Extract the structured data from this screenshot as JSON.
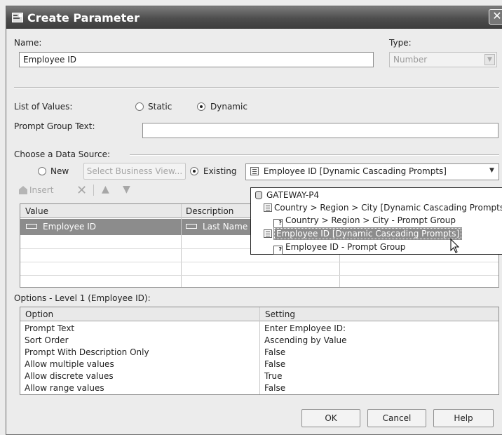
{
  "window": {
    "title": "Create Parameter",
    "close_glyph": "✕"
  },
  "name_section": {
    "name_label": "Name:",
    "name_value": "Employee ID",
    "type_label": "Type:",
    "type_value": "Number"
  },
  "list_of_values": {
    "label": "List of Values:",
    "static_label": "Static",
    "dynamic_label": "Dynamic",
    "selected": "Dynamic"
  },
  "prompt_group": {
    "label": "Prompt Group Text:",
    "value": ""
  },
  "data_source": {
    "label": "Choose a Data Source:",
    "new_label": "New",
    "select_business_view_label": "Select Business View...",
    "existing_label": "Existing",
    "selected_source": "Employee ID [Dynamic Cascading Prompts]",
    "selected_option": "Existing"
  },
  "toolbar": {
    "insert_label": "Insert",
    "delete_icon": "delete-icon",
    "up_icon": "arrow-up-icon",
    "down_icon": "arrow-down-icon"
  },
  "value_grid": {
    "columns": [
      "Value",
      "Description"
    ],
    "rows": [
      {
        "value": "Employee ID",
        "description": "Last Name"
      }
    ]
  },
  "dropdown_popup": {
    "items": [
      {
        "text": "GATEWAY-P4",
        "icon": "database-icon",
        "indent": 0,
        "selected": false
      },
      {
        "text": "Country > Region > City [Dynamic Cascading Prompts]",
        "icon": "cascade-prompt-icon",
        "indent": 1,
        "selected": false
      },
      {
        "text": "Country > Region > City - Prompt Group",
        "icon": "prompt-group-icon",
        "indent": 2,
        "selected": false
      },
      {
        "text": "Employee ID [Dynamic Cascading Prompts]",
        "icon": "cascade-prompt-icon",
        "indent": 1,
        "selected": true
      },
      {
        "text": "Employee ID - Prompt Group",
        "icon": "prompt-group-icon",
        "indent": 2,
        "selected": false
      }
    ]
  },
  "options": {
    "section_label": "Options - Level 1 (Employee ID):",
    "columns": [
      "Option",
      "Setting"
    ],
    "rows": [
      {
        "option": "Prompt Text",
        "setting": "Enter Employee ID:"
      },
      {
        "option": "Sort Order",
        "setting": "Ascending by Value"
      },
      {
        "option": "Prompt With Description Only",
        "setting": "False"
      },
      {
        "option": "Allow multiple values",
        "setting": "False"
      },
      {
        "option": "Allow discrete values",
        "setting": "True"
      },
      {
        "option": "Allow range values",
        "setting": "False"
      }
    ]
  },
  "buttons": {
    "ok": "OK",
    "cancel": "Cancel",
    "help": "Help"
  }
}
